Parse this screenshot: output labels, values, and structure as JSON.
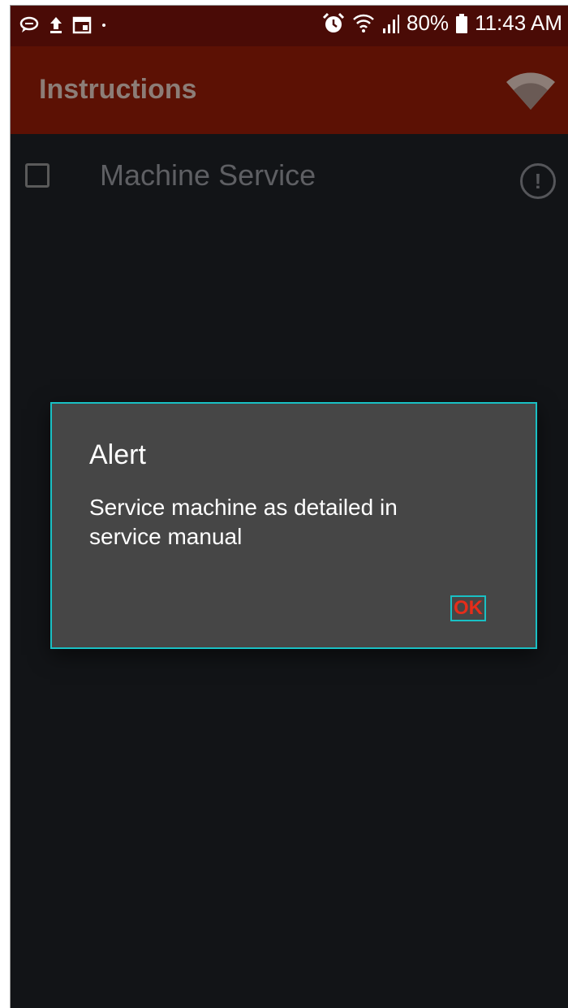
{
  "status_bar": {
    "left_icons": [
      "chat-bubble-icon",
      "upload-icon",
      "calendar-icon",
      "dot-icon"
    ],
    "right_icons": [
      "alarm-icon",
      "wifi-icon",
      "signal-icon",
      "battery-icon"
    ],
    "battery": "80%",
    "time": "11:43 AM"
  },
  "app_bar": {
    "title": "Instructions",
    "right_icon": "wifi-icon"
  },
  "list": {
    "items": [
      {
        "label": "Machine Service",
        "checked": false,
        "icon": "alert-circle-icon"
      }
    ]
  },
  "dialog": {
    "title": "Alert",
    "message": "Service machine as detailed in service manual",
    "ok_label": "OK"
  },
  "colors": {
    "status_bar": "#4a0b06",
    "app_bar": "#5c1104",
    "background": "#121417",
    "dialog": "#464646",
    "highlight": "#19c0c4",
    "ok_text": "#e52d1a"
  }
}
